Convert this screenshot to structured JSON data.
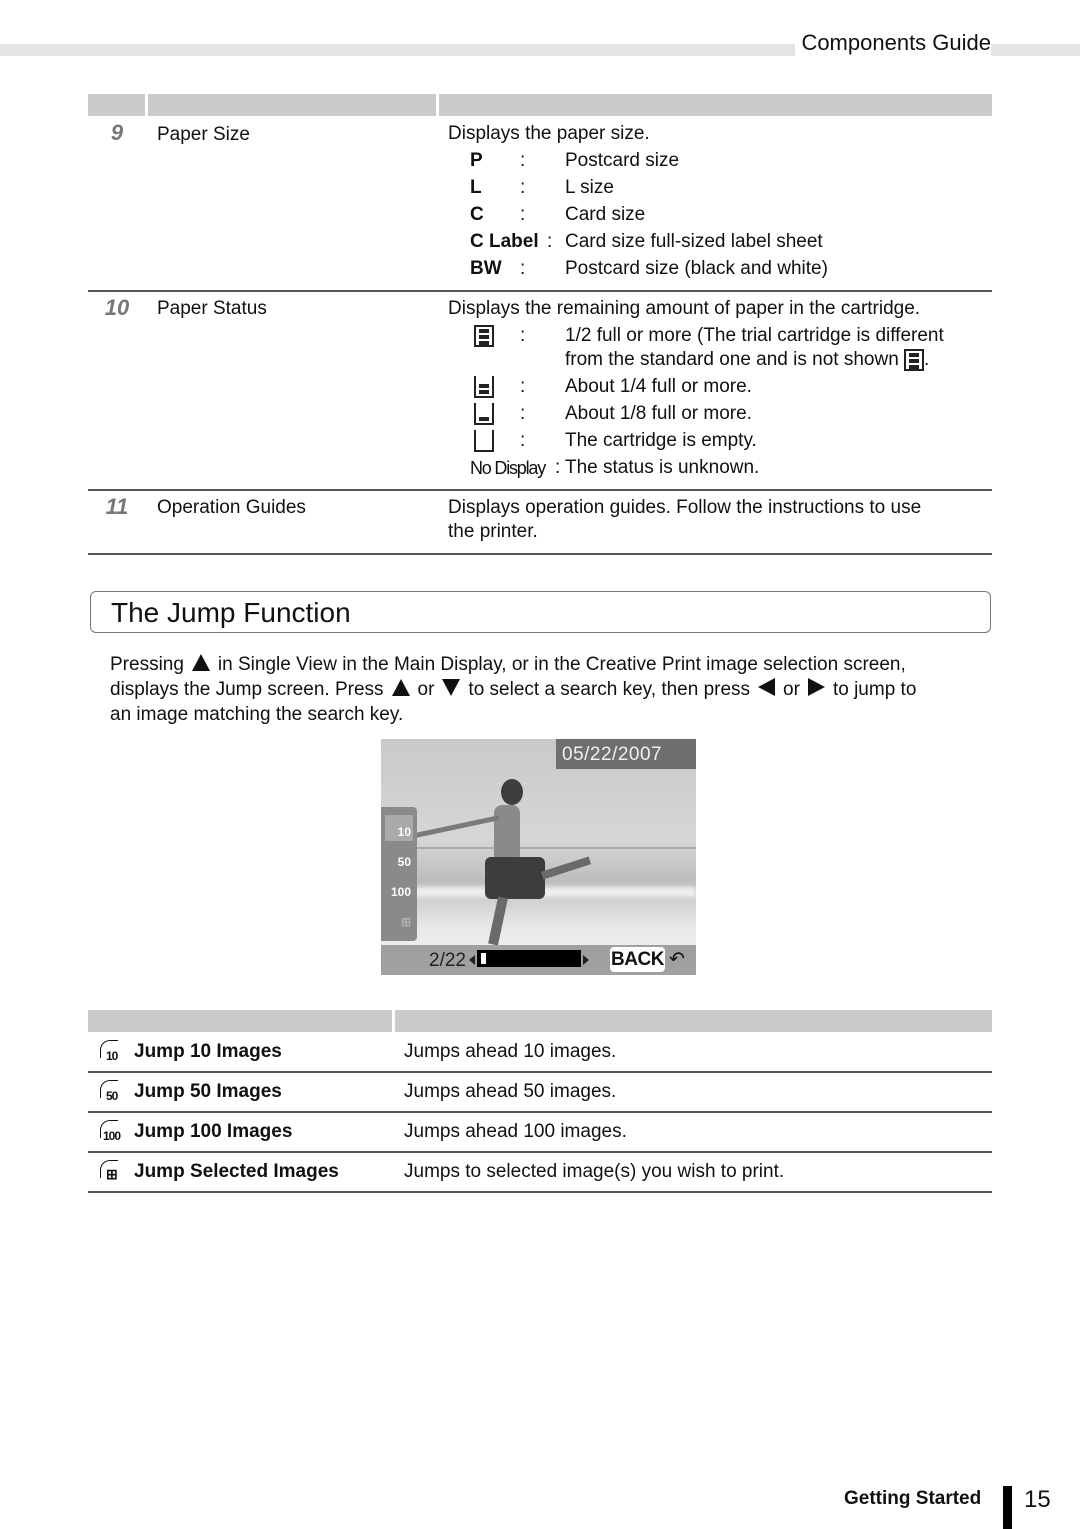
{
  "header": {
    "title": "Components Guide"
  },
  "components_table": {
    "rows": [
      {
        "number": "9",
        "name": "Paper Size",
        "description": "Displays the paper size.",
        "items": [
          {
            "key": "P",
            "sep": ":",
            "value": "Postcard size"
          },
          {
            "key": "L",
            "sep": ":",
            "value": "L size"
          },
          {
            "key": "C",
            "sep": ":",
            "value": "Card size"
          },
          {
            "key": "C Label",
            "sep": ":",
            "value": "Card size full-sized label sheet"
          },
          {
            "key": "BW",
            "sep": ":",
            "value": "Postcard size (black and white)"
          }
        ]
      },
      {
        "number": "10",
        "name": "Paper Status",
        "description": "Displays the remaining amount of paper in the cartridge.",
        "items": [
          {
            "icon": "paper-level-half-icon",
            "sep": ":",
            "value": "1/2 full or more (The trial cartridge is different",
            "value2": "from the standard one and is not shown"
          },
          {
            "icon": "paper-level-quarter-icon",
            "sep": ":",
            "value": "About 1/4 full or more."
          },
          {
            "icon": "paper-level-eighth-icon",
            "sep": ":",
            "value": "About 1/8 full or more."
          },
          {
            "icon": "paper-level-empty-icon",
            "sep": ":",
            "value": "The cartridge is empty."
          },
          {
            "key": "No Display",
            "sep": ":",
            "value": "The status is unknown."
          }
        ]
      },
      {
        "number": "11",
        "name": "Operation Guides",
        "description": "Displays operation guides. Follow the instructions to use",
        "description2": "the printer."
      }
    ]
  },
  "section": {
    "title": "The Jump Function",
    "paragraph": {
      "p1": "Pressing",
      "p2": "in Single View in the Main Display, or in the Creative Print image selection screen,",
      "p3": "displays the Jump screen. Press",
      "p4": "or",
      "p5": "to select a search key, then press",
      "p6": "or",
      "p7": "to jump to",
      "p8": "an image matching the search key."
    }
  },
  "screen": {
    "date": "05/22/2007",
    "counter": "2/22",
    "progress_fraction": 0.09,
    "back_label": "BACK",
    "back_arrow": "↶",
    "jump_icons": [
      {
        "label": "10",
        "selected": true
      },
      {
        "label": "50",
        "selected": false
      },
      {
        "label": "100",
        "selected": false
      },
      {
        "label": "⊞",
        "selected": false,
        "dimmed": true
      }
    ]
  },
  "jump_table": {
    "rows": [
      {
        "icon_label": "10",
        "name": "Jump 10 Images",
        "description": "Jumps ahead 10 images."
      },
      {
        "icon_label": "50",
        "name": "Jump 50 Images",
        "description": "Jumps ahead 50 images."
      },
      {
        "icon_label": "100",
        "name": "Jump 100 Images",
        "description": "Jumps ahead 100 images."
      },
      {
        "icon_label": "⊞",
        "name": "Jump Selected Images",
        "description": "Jumps to selected image(s) you wish to print."
      }
    ]
  },
  "footer": {
    "section": "Getting Started",
    "page": "15"
  }
}
